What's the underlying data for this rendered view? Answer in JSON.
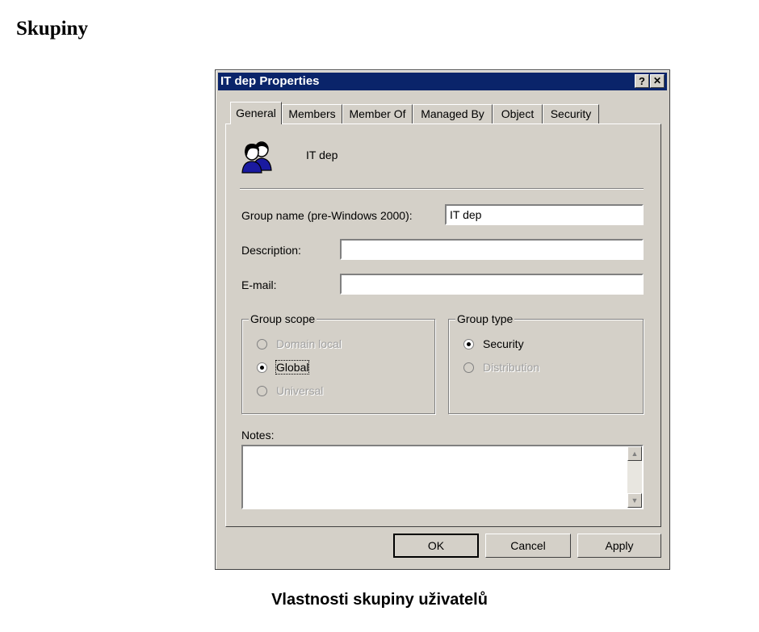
{
  "document": {
    "heading": "Skupiny",
    "caption": "Vlastnosti skupiny uživatelů"
  },
  "dialog": {
    "title": "IT dep Properties",
    "help_button": "?",
    "close_button": "✕",
    "tabs": [
      {
        "label": "General",
        "active": true
      },
      {
        "label": "Members",
        "active": false
      },
      {
        "label": "Member Of",
        "active": false
      },
      {
        "label": "Managed By",
        "active": false
      },
      {
        "label": "Object",
        "active": false
      },
      {
        "label": "Security",
        "active": false
      }
    ],
    "group_icon": "users-group-icon",
    "group_display_name": "IT dep",
    "fields": {
      "group_name_label": "Group name (pre-Windows 2000):",
      "group_name_value": "IT dep",
      "description_label": "Description:",
      "description_value": "",
      "email_label": "E-mail:",
      "email_value": ""
    },
    "group_scope": {
      "title": "Group scope",
      "options": [
        {
          "label": "Domain local",
          "checked": false,
          "enabled": false
        },
        {
          "label": "Global",
          "checked": true,
          "enabled": true
        },
        {
          "label": "Universal",
          "checked": false,
          "enabled": false
        }
      ]
    },
    "group_type": {
      "title": "Group type",
      "options": [
        {
          "label": "Security",
          "checked": true,
          "enabled": true
        },
        {
          "label": "Distribution",
          "checked": false,
          "enabled": false
        }
      ]
    },
    "notes": {
      "label": "Notes:",
      "value": ""
    },
    "buttons": {
      "ok": "OK",
      "cancel": "Cancel",
      "apply": "Apply"
    }
  },
  "colors": {
    "titlebar": "#0a246a",
    "face": "#d4d0c8",
    "disabled_text": "#a0a0a0"
  }
}
